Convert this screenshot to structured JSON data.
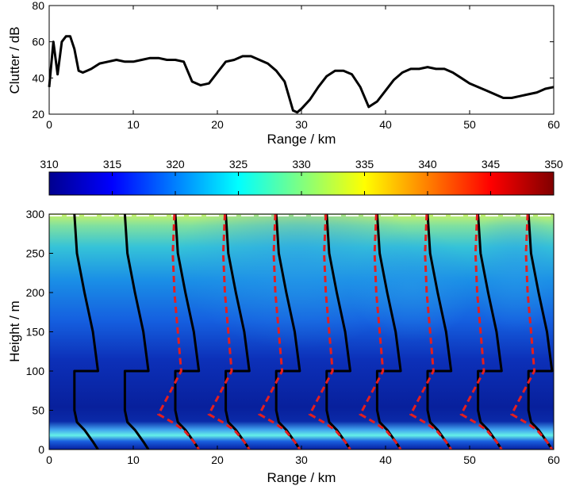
{
  "chart_data": [
    {
      "type": "line",
      "xlabel": "Range / km",
      "ylabel": "Clutter / dB",
      "xlim": [
        0,
        60
      ],
      "ylim": [
        20,
        80
      ],
      "xticks": [
        0,
        10,
        20,
        30,
        40,
        50,
        60
      ],
      "yticks": [
        20,
        40,
        60,
        80
      ],
      "grid": false,
      "series": [
        {
          "color": "#000000",
          "x": [
            0,
            0.5,
            1.0,
            1.5,
            2.0,
            2.5,
            3.0,
            3.5,
            4.0,
            4.5,
            5.0,
            6.0,
            7.0,
            8.0,
            9.0,
            10.0,
            11.0,
            12.0,
            13.0,
            14.0,
            15.0,
            16.0,
            17.0,
            18.0,
            19.0,
            20.0,
            21.0,
            22.0,
            23.0,
            24.0,
            25.0,
            26.0,
            27.0,
            28.0,
            29.0,
            29.5,
            30.0,
            31.0,
            32.0,
            33.0,
            34.0,
            35.0,
            36.0,
            37.0,
            38.0,
            39.0,
            40.0,
            41.0,
            42.0,
            43.0,
            44.0,
            45.0,
            46.0,
            47.0,
            48.0,
            49.0,
            50.0,
            51.0,
            52.0,
            53.0,
            54.0,
            55.0,
            56.0,
            57.0,
            58.0,
            59.0,
            60.0
          ],
          "y": [
            35,
            60,
            42,
            60,
            63,
            63,
            56,
            44,
            43,
            44,
            45,
            48,
            49,
            50,
            49,
            49,
            50,
            51,
            51,
            50,
            50,
            49,
            38,
            36,
            37,
            43,
            49,
            50,
            52,
            52,
            50,
            48,
            44,
            38,
            22,
            21,
            23,
            28,
            35,
            41,
            44,
            44,
            42,
            35,
            24,
            27,
            33,
            39,
            43,
            45,
            45,
            46,
            45,
            45,
            43,
            40,
            37,
            35,
            33,
            31,
            29,
            29,
            30,
            31,
            32,
            34,
            35
          ]
        }
      ]
    },
    {
      "type": "heatmap",
      "xlabel": "Range / km",
      "ylabel": "Height / m",
      "xlim": [
        0,
        60
      ],
      "ylim": [
        0,
        300
      ],
      "xticks": [
        0,
        10,
        20,
        30,
        40,
        50,
        60
      ],
      "yticks": [
        0,
        50,
        100,
        150,
        200,
        250,
        300
      ],
      "colorbar": {
        "min": 310,
        "max": 350,
        "ticks": [
          310,
          315,
          320,
          325,
          330,
          335,
          340,
          345,
          350
        ],
        "placement": "top",
        "colormap": "jet"
      },
      "profiles_black": [
        {
          "x": [
            3.0,
            3.3,
            4.2,
            5.2,
            5.8
          ],
          "y": [
            300,
            250,
            200,
            150,
            100
          ]
        },
        {
          "x": [
            3.0,
            3.0,
            3.3,
            4.2,
            5.2,
            5.8
          ],
          "y": [
            100,
            50,
            35,
            25,
            10,
            0
          ]
        }
      ],
      "profile_offsets_km": [
        0,
        6,
        12,
        18,
        24,
        30,
        36,
        42,
        48,
        54
      ],
      "profiles_red_dashed_from_km": 12,
      "colors": {
        "curve": "#000000",
        "profile_black": "#000000",
        "profile_red": "#e51e1e"
      }
    }
  ]
}
